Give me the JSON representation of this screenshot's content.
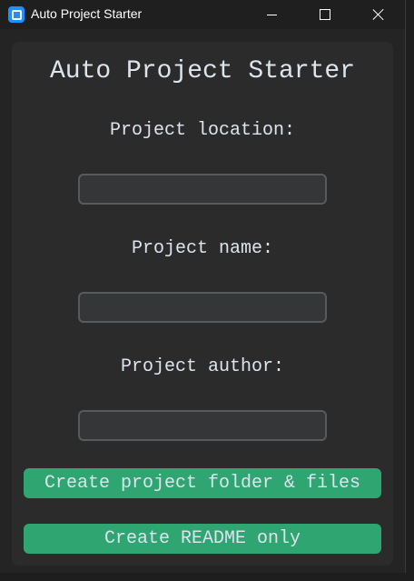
{
  "window": {
    "title": "Auto Project Starter",
    "controls": [
      "minimize",
      "maximize",
      "close"
    ]
  },
  "form": {
    "heading": "Auto Project Starter",
    "location_label": "Project location:",
    "location_value": "",
    "name_label": "Project name:",
    "name_value": "",
    "author_label": "Project author:",
    "author_value": ""
  },
  "actions": {
    "create_files_label": "Create project folder & files",
    "readme_only_label": "Create README only"
  },
  "colors": {
    "accent": "#2fa572",
    "panel": "#2b2b2b",
    "window": "#242424",
    "text": "#dce4ee",
    "app_icon": "#1e90ff"
  },
  "icons": {
    "app": "app-icon",
    "minimize": "minimize-icon",
    "maximize": "maximize-icon",
    "close": "close-icon"
  }
}
